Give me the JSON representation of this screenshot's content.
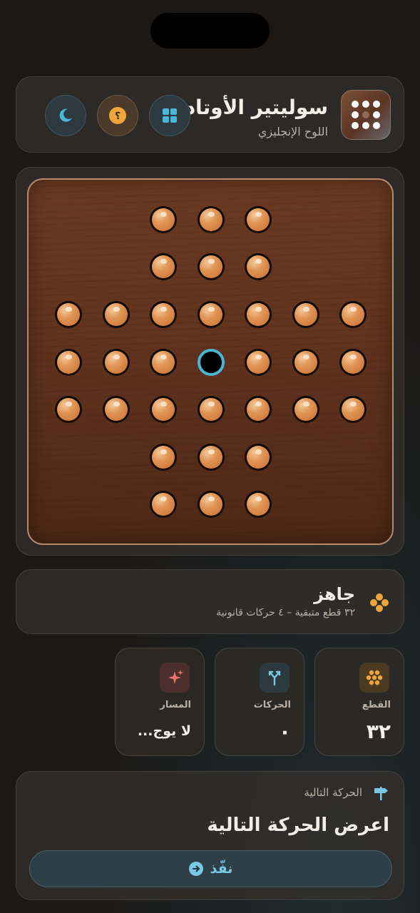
{
  "header": {
    "title": "سوليتير الأوتاد",
    "subtitle": "اللوح الإنجليزي",
    "icons": [
      "grid-icon",
      "help-icon",
      "moon-icon"
    ]
  },
  "board": {
    "type": "english",
    "empty_cell": "center",
    "colors": {
      "peg": "#e09455",
      "empty_ring": "#4ab6d6",
      "wood": "#5e321d"
    }
  },
  "status": {
    "title": "جاهز",
    "subtitle": "٣٢ قطع متبقية – ٤ حركات قانونية"
  },
  "stats": [
    {
      "label": "القطع",
      "value": "٣٢",
      "icon": "pegs-icon"
    },
    {
      "label": "الحركات",
      "value": "٠",
      "icon": "moves-icon"
    },
    {
      "label": "المسار",
      "value": "لا يوج...",
      "icon": "sparkle-icon"
    }
  ],
  "next_move": {
    "label": "الحركة التالية",
    "title": "اعرض الحركة التالية",
    "button_label": "نفّذ"
  },
  "colors": {
    "accent": "#78c8e6",
    "background": "#1b1816"
  }
}
